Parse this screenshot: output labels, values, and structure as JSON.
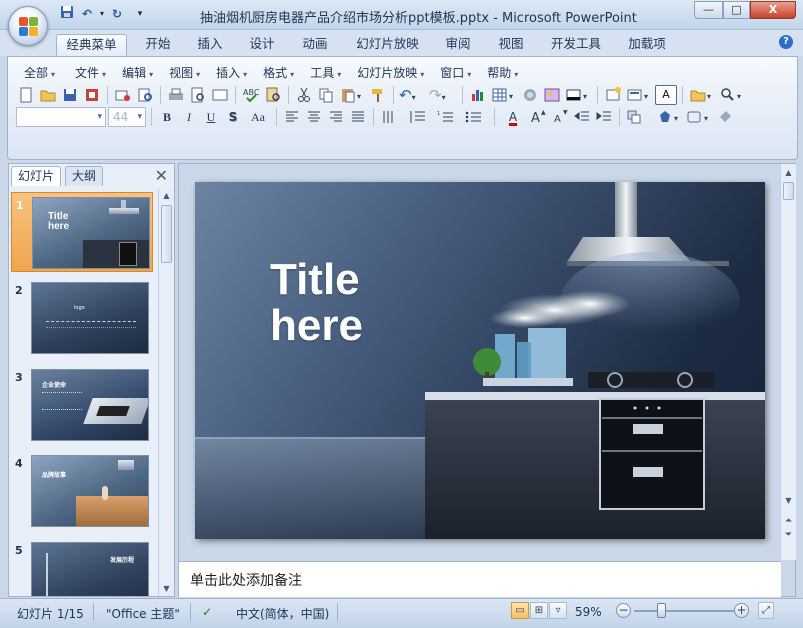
{
  "app": {
    "window_title": "抽油烟机厨房电器产品介绍市场分析ppt模板.pptx - Microsoft PowerPoint",
    "controls": {
      "minimize": "—",
      "maximize": "□",
      "close": "X"
    }
  },
  "qat": {
    "icons": [
      "save-icon",
      "undo-icon",
      "redo-icon",
      "customize-icon"
    ]
  },
  "ribbon_tabs": [
    "经典菜单",
    "开始",
    "插入",
    "设计",
    "动画",
    "幻灯片放映",
    "审阅",
    "视图",
    "开发工具",
    "加载项"
  ],
  "active_tab": "经典菜单",
  "menu": [
    "全部",
    "文件",
    "编辑",
    "视图",
    "插入",
    "格式",
    "工具",
    "幻灯片放映",
    "窗口",
    "帮助"
  ],
  "toolbar": {
    "font_name": "",
    "font_size": "44",
    "bold": "B",
    "italic": "I",
    "underline": "U",
    "shadow": "S",
    "change_case": "Aa",
    "font_color": "A",
    "text_box": "A"
  },
  "left_panel": {
    "tabs": [
      "幻灯片",
      "大纲"
    ],
    "active_tab": "幻灯片",
    "slides": [
      {
        "number": "1",
        "title": "Title here",
        "selected": true
      },
      {
        "number": "2",
        "title": "logo",
        "selected": false
      },
      {
        "number": "3",
        "title": "企业使命",
        "selected": false
      },
      {
        "number": "4",
        "title": "品牌故事",
        "selected": false
      },
      {
        "number": "5",
        "title": "发展历程",
        "selected": false
      }
    ]
  },
  "slide": {
    "title_line1": "Title",
    "title_line2": "here"
  },
  "notes": {
    "placeholder": "单击此处添加备注"
  },
  "status": {
    "slide_counter": "幻灯片 1/15",
    "theme": "\"Office 主题\"",
    "language": "中文(简体，中国)",
    "zoom": "59%",
    "zoom_level_percent": 59
  },
  "colors": {
    "accent_orange": "#f0a54d",
    "ribbon_blue": "#dce8f6",
    "slide_dark": "#1c2b41"
  }
}
